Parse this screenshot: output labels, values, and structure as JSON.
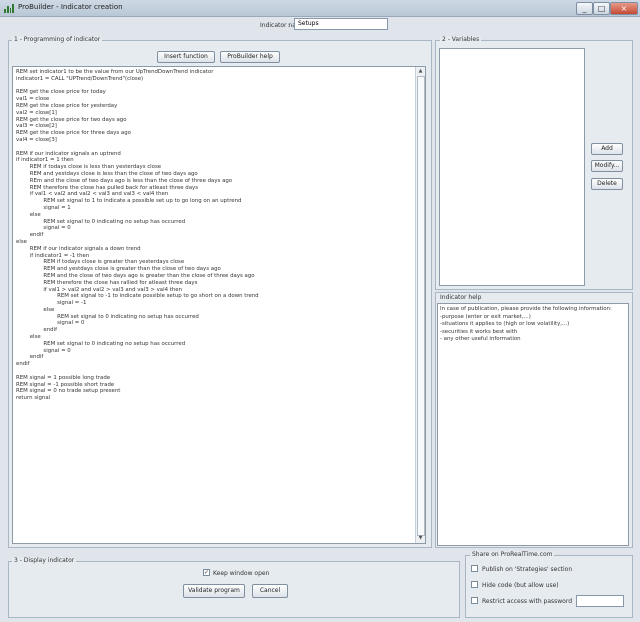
{
  "window": {
    "title": "ProBuilder - Indicator creation",
    "controls": [
      "_",
      "□",
      "×"
    ]
  },
  "indicator_name": {
    "label": "Indicator name",
    "value": "Setups"
  },
  "programming": {
    "title": "1 - Programming of indicator",
    "insert_function_label": "Insert function",
    "probuilder_help_label": "ProBuilder help",
    "code": "REM set indicator1 to be the value from our UpTrendDownTrend indicator\nindicator1 = CALL \"UPTrend/DownTrend\"(close)\n\nREM get the close price for today\nval1 = close\nREM get the close price for yesterday\nval2 = close[1]\nREM get the close price for two days ago\nval3 = close[2]\nREM get the close price for three days ago\nval4 = close[3]\n\nREM if our indicator signals an uptrend\nif indicator1 = 1 then\n        REM if todays close is less than yesterdays close\n        REM and yestdays close is less than the close of two days ago\n        REm and the close of two days ago is less than the close of three days ago\n        REM therefore the close has pulled back for atleast three days\n        if val1 < val2 and val2 < val3 and val3 < val4 then\n                REM set signal to 1 to indicate a possible set up to go long on an uptrend\n                signal = 1\n        else\n                REM set signal to 0 indicating no setup has occurred\n                signal = 0\n        endif\nelse\n        REM if our indicator signals a down trend\n        if indicator1 = -1 then\n                REM if todays close is greater than yesterdays close\n                REM and yestdays close is greater than the close of two days ago\n                REM and the close of two days ago is greater than the close of three days ago\n                REM therefore the close has rallied for atleast three days\n                if val1 > val2 and val2 > val3 and val3 > val4 then\n                        REM set signal to -1 to indicate possible setup to go short on a down trend\n                        signal = -1\n                else\n                        REM set signal to 0 indicating no setup has occurred\n                        signal = 0\n                endif\n        else\n                REM set signal to 0 indicating no setup has occurred\n                signal = 0\n        endif\nendif\n\nREM signal = 1 possible long trade\nREM signal = -1 possible short trade\nREM signal = 0 no trade setup present\nreturn signal",
    "scroll_up_icon": "▲",
    "scroll_down_icon": "▼"
  },
  "variables": {
    "title": "2 - Variables",
    "add_label": "Add",
    "modify_label": "Modify...",
    "delete_label": "Delete"
  },
  "indicator_help": {
    "title": "Indicator help",
    "text": "In case of publication, please provide the following information:\n-purpose (enter or exit market,...)\n-situations it applies to (high or low volatility,...)\n-securities it works best with\n- any other useful information"
  },
  "display": {
    "title": "3 - Display indicator",
    "keep_window_open_label": "Keep window open",
    "keep_window_open_checked": true,
    "validate_label": "Validate program",
    "cancel_label": "Cancel"
  },
  "share": {
    "title": "Share on ProRealTime.com",
    "publish_label": "Publish on 'Strategies' section",
    "hide_code_label": "Hide code (but allow use)",
    "restrict_label": "Restrict access with password",
    "password_value": ""
  },
  "colors": {
    "accent": "#2f7a2f",
    "panel_bg": "#e6ebf0",
    "border": "#a9b6c4"
  }
}
